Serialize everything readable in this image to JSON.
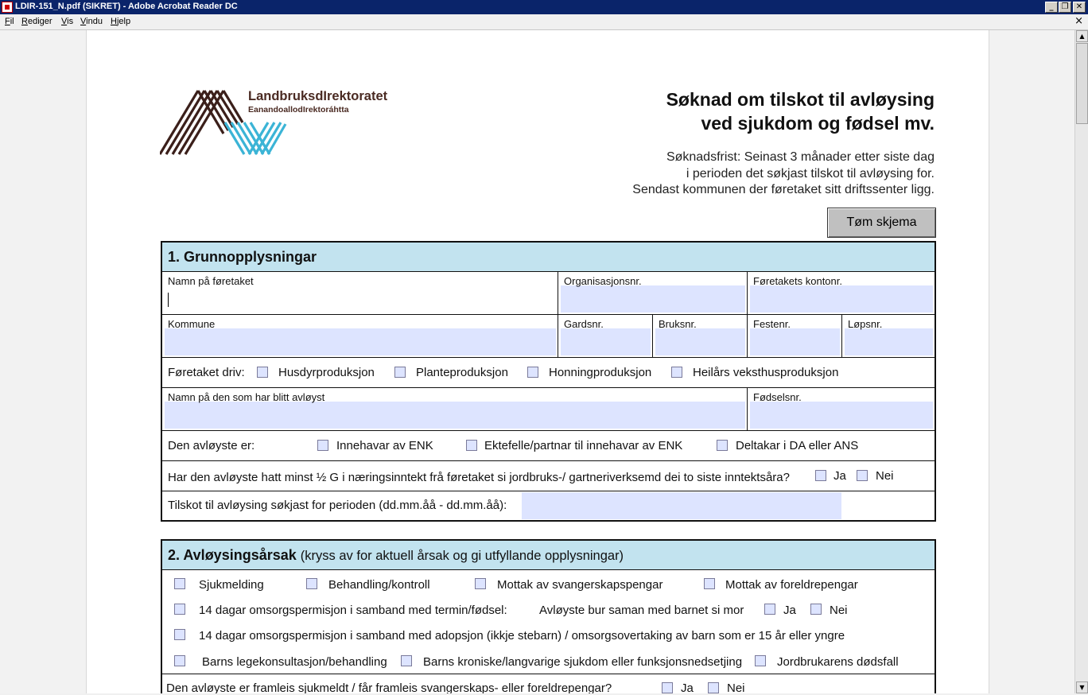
{
  "window": {
    "title": "LDIR-151_N.pdf (SIKRET) - Adobe Acrobat Reader DC",
    "min": "_",
    "restore": "❐",
    "close": "✕"
  },
  "menu": [
    "Fil",
    "Rediger",
    "Vis",
    "Vindu",
    "Hjelp"
  ],
  "menu_close": "×",
  "scroll": {
    "up": "▲",
    "down": "▼"
  },
  "logo": {
    "name": "LandbruksdIrektoratet",
    "sub": "EanandoallodIrektoráhtta",
    "colors": {
      "brown": "#3b1f1a",
      "cyan": "#3bb4d6"
    }
  },
  "header": {
    "title_line1": "Søknad om tilskot til avløysing",
    "title_line2": "ved sjukdom og fødsel mv.",
    "deadline_line1": "Søknadsfrist: Seinast 3 månader etter siste dag",
    "deadline_line2": "i perioden det søkjast tilskot til avløysing for.",
    "deadline_line3": "Sendast kommunen der føretaket sitt driftssenter ligg.",
    "reset_label": "Tøm skjema"
  },
  "section1": {
    "title": "1. Grunnopplysningar",
    "company_name_label": "Namn på føretaket",
    "org_number_label": "Organisasjonsnr.",
    "account_label": "Føretakets kontonr.",
    "municipality_label": "Kommune",
    "gardsnr_label": "Gardsnr.",
    "bruksnr_label": "Bruksnr.",
    "festenr_label": "Festenr.",
    "lopsnr_label": "Løpsnr.",
    "drives_label": "Føretaket driv:",
    "drives_options": [
      "Husdyrproduksjon",
      "Planteproduksjon",
      "Honningproduksjon",
      "Heilårs veksthusproduksjon"
    ],
    "relieved_name_label": "Namn på den som har blitt avløyst",
    "birth_number_label": "Fødselsnr.",
    "relieved_is_label": "Den avløyste er:",
    "relieved_is_options": [
      "Innehavar av ENK",
      "Ektefelle/partnar til innehavar av ENK",
      "Deltakar i DA eller ANS"
    ],
    "income_question": "Har den avløyste hatt minst ½ G i næringsinntekt frå føretaket si jordbruks-/ gartneriverksemd dei to siste inntektsåra?",
    "yes": "Ja",
    "no": "Nei",
    "period_label": "Tilskot til avløysing søkjast for perioden (dd.mm.åå - dd.mm.åå):"
  },
  "section2": {
    "title": "2. Avløysingsårsak",
    "subtitle": "(kryss av for aktuell årsak og gi utfyllande opplysningar)",
    "row1": [
      "Sjukmelding",
      "Behandling/kontroll",
      "Mottak av svangerskapspengar",
      "Mottak av foreldrepengar"
    ],
    "row2_label": "14 dagar omsorgspermisjon i samband med termin/fødsel:",
    "row2_question": "Avløyste bur saman med barnet si mor",
    "row3_label": "14 dagar omsorgspermisjon i samband med adopsjon (ikkje stebarn) / omsorgsovertaking av barn som er 15 år eller yngre",
    "row4": [
      "Barns legekonsultasjon/behandling",
      "Barns kroniske/langvarige sjukdom eller funksjonsnedsetjing",
      "Jordbrukarens dødsfall"
    ],
    "continued_label": "Den avløyste er framleis sjukmeldt / får framleis svangerskaps- eller foreldrepengar?",
    "yes": "Ja",
    "no": "Nei"
  }
}
